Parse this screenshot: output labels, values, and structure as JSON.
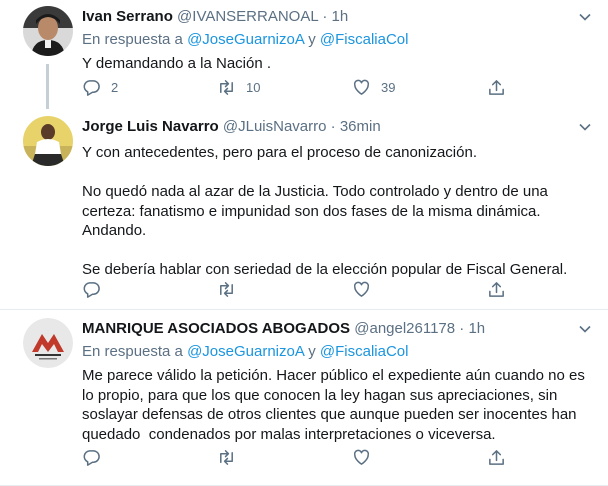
{
  "tweets": [
    {
      "name": "Ivan Serrano",
      "handle": "@IVANSERRANOAL",
      "separator": "·",
      "time": "1h",
      "reply_prefix": "En respuesta a",
      "reply_mention1": "@JoseGuarnizoA",
      "reply_joiner": "y",
      "reply_mention2": "@FiscaliaCol",
      "text": "Y demandando a la Nación .",
      "replies": "2",
      "retweets": "10",
      "likes": "39"
    },
    {
      "name": "Jorge Luis Navarro",
      "handle": "@JLuisNavarro",
      "separator": "·",
      "time": "36min",
      "text": "Y con antecedentes, pero para el proceso de canonización.\n\nNo quedó nada al azar de la Justicia. Todo controlado y dentro de una\ncerteza: fanatismo e impunidad son dos fases de la misma dinámica.\nAndando.\n\nSe debería hablar con seriedad de la elección popular de Fiscal General."
    },
    {
      "name": "MANRIQUE ASOCIADOS ABOGADOS",
      "handle": "@angel261178",
      "separator": "·",
      "time": "1h",
      "reply_prefix": "En respuesta a",
      "reply_mention1": "@JoseGuarnizoA",
      "reply_joiner": "y",
      "reply_mention2": "@FiscaliaCol",
      "text": "Me parece válido la petición. Hacer público el expediente aún cuando no es\nlo propio, para que los que conocen la ley hagan sus apreciaciones, sin\nsoslayar defensas de otros clientes que aunque pueden ser inocentes han\nquedado  condenados por malas interpretaciones o viceversa."
    }
  ],
  "colors": {
    "link": "#1b95e0",
    "muted": "#5b7083",
    "line": "#c4cfd6"
  },
  "icons": [
    "reply-icon",
    "retweet-icon",
    "like-icon",
    "share-icon",
    "chevron-down-icon"
  ]
}
